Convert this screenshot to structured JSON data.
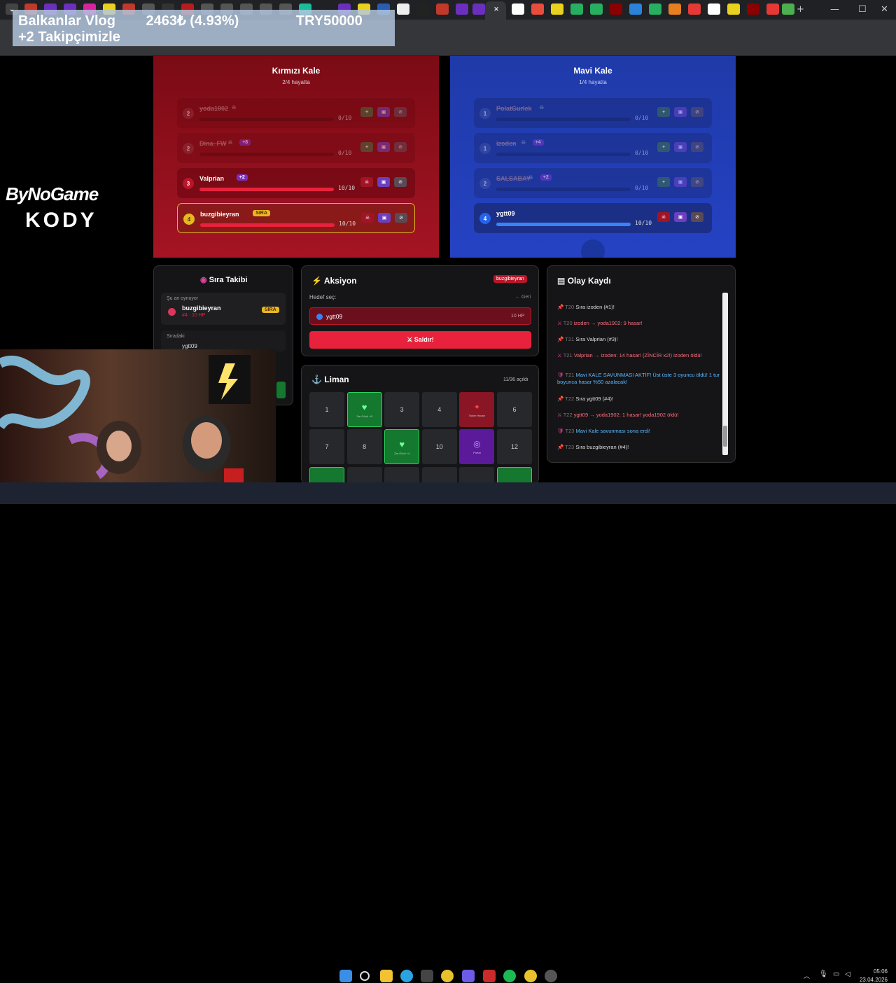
{
  "browser": {
    "tabs": [
      "Balkanlar Vlog"
    ],
    "minimize": "—",
    "maximize": "☐",
    "close": "✕",
    "new_tab": "+"
  },
  "overlay": {
    "ticker_line1_a": "Balkanlar Vlog",
    "ticker_line1_b": "2463₺ (4.93%)",
    "ticker_line1_c": "TRY50000",
    "ticker_line2": "+2 Takipçimizle"
  },
  "sponsors": {
    "bynogame": "ByNoGame",
    "kody": "KODY"
  },
  "red_team": {
    "title": "Kırmızı Kale",
    "subtitle": "2/4 hayatta",
    "players": [
      {
        "num": "2",
        "name": "yoda1902",
        "hp": "0/10",
        "hp_fraction": 0,
        "badge": ""
      },
      {
        "num": "2",
        "name": "Dina_FW",
        "hp": "0/10",
        "hp_fraction": 0,
        "badge": "+8"
      },
      {
        "num": "3",
        "name": "Valprian",
        "hp": "10/10",
        "hp_fraction": 1,
        "badge": "+2"
      },
      {
        "num": "4",
        "name": "buzgibieyran",
        "hp": "10/10",
        "hp_fraction": 1,
        "badge": "SIRA"
      }
    ]
  },
  "blue_team": {
    "title": "Mavi Kale",
    "subtitle": "1/4 hayatta",
    "players": [
      {
        "num": "1",
        "name": "PolatGurlek",
        "hp": "0/10",
        "hp_fraction": 0,
        "badge": ""
      },
      {
        "num": "1",
        "name": "izoden",
        "hp": "0/10",
        "hp_fraction": 0,
        "badge": "+4"
      },
      {
        "num": "2",
        "name": "SALSABAY",
        "hp": "0/10",
        "hp_fraction": 0,
        "badge": "+2"
      },
      {
        "num": "4",
        "name": "ygtt09",
        "hp": "10/10",
        "hp_fraction": 1,
        "badge": ""
      }
    ]
  },
  "sira_takibi": {
    "title": "Sıra Takibi",
    "current_label": "Şu an oynuyor",
    "current_name": "buzgibieyran",
    "current_detail": "#4 · 10 HP",
    "current_badge": "SIRA",
    "next_label": "Sıradaki",
    "next_name": "ygtt09"
  },
  "aksiyon": {
    "title": "Aksiyon",
    "player_badge": "buzgibieyran",
    "target_label": "Hedef seç:",
    "back": "← Geri",
    "target_name": "ygtt09",
    "target_hp": "10 HP",
    "attack_button": "Saldır!"
  },
  "liman": {
    "title": "Liman",
    "opened": "11/36 açıldı",
    "cells": [
      {
        "label": "1",
        "sub": "",
        "kind": "plain"
      },
      {
        "label": "♥",
        "sub": "Zar Gücü +8",
        "kind": "green"
      },
      {
        "label": "3",
        "sub": "",
        "kind": "plain"
      },
      {
        "label": "4",
        "sub": "",
        "kind": "plain"
      },
      {
        "label": "✦",
        "sub": "Takım Hasarı",
        "kind": "red"
      },
      {
        "label": "6",
        "sub": "",
        "kind": "plain"
      },
      {
        "label": "7",
        "sub": "",
        "kind": "plain"
      },
      {
        "label": "8",
        "sub": "",
        "kind": "plain"
      },
      {
        "label": "♥",
        "sub": "Zar Gücü +4",
        "kind": "green"
      },
      {
        "label": "10",
        "sub": "",
        "kind": "plain"
      },
      {
        "label": "◎",
        "sub": "Portal",
        "kind": "purple"
      },
      {
        "label": "12",
        "sub": "",
        "kind": "plain"
      }
    ]
  },
  "olay": {
    "title": "Olay Kaydı",
    "entries": [
      {
        "t": "T20",
        "text": "Sıra izoden (#1)!"
      },
      {
        "t": "T20",
        "text": "izoden → yoda1902: 9 hasar!"
      },
      {
        "t": "T21",
        "text": "Sıra Valprian (#3)!"
      },
      {
        "t": "T21",
        "text": "Valprian → izoden: 14 hasar! (ZİNCİR x2!) izoden öldü!"
      },
      {
        "t": "T21",
        "text": "Mavi KALE SAVUNMASI AKTİF! Üst üste 3 oyuncu öldü! 1 tur boyunca hasar %50 azalacak!"
      },
      {
        "t": "T22",
        "text": "Sıra ygtt09 (#4)!"
      },
      {
        "t": "T22",
        "text": "ygtt09 → yoda1902: 1 hasar! yoda1902 öldü!"
      },
      {
        "t": "T23",
        "text": "Mavi Kale savunması sona erdi!"
      },
      {
        "t": "T23",
        "text": "Sıra buzgibieyran (#4)!"
      }
    ]
  },
  "taskbar": {
    "time": "05:06",
    "date": "23.04.2026"
  }
}
